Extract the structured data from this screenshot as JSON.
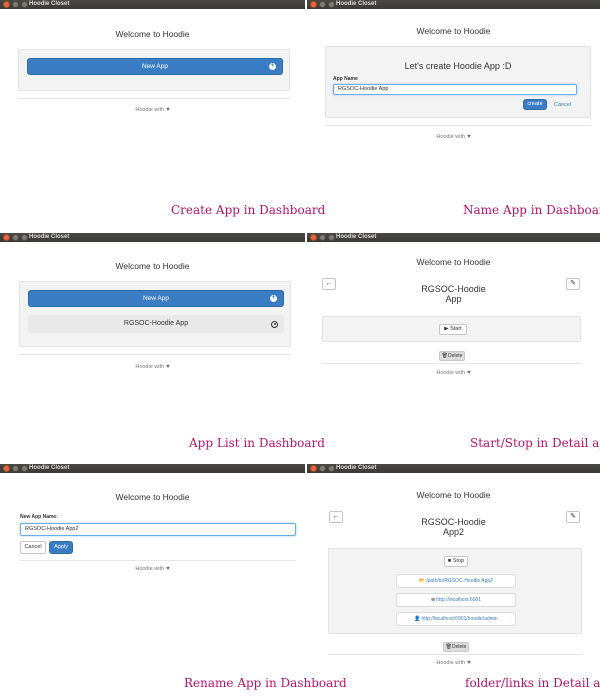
{
  "window_title": "Hoodie Closet",
  "welcome": "Welcome to Hoodie",
  "footer_text": "Hoodie with",
  "heart_icon": "♥",
  "colors": {
    "primary": "#3a7dc5",
    "caption": "#b4146e",
    "titlebar": "#3c3b37"
  },
  "panel1": {
    "new_app_label": "New App",
    "caption": "Create App in Dashboard"
  },
  "panel2": {
    "heading": "Let's create Hoodie App :D",
    "field_label": "App Name",
    "field_value": "RGSOC-Hoodie App",
    "create_label": "create",
    "cancel_label": "Cancel",
    "caption": "Name App in Dashboard"
  },
  "panel3": {
    "new_app_label": "New App",
    "list_item": "RGSOC-Hoodie App",
    "caption": "App List in Dashboard"
  },
  "panel4": {
    "app_name_line1": "RGSOC-Hoodie",
    "app_name_line2": "App",
    "start_label": "Start",
    "delete_label": "Delete",
    "caption": "Start/Stop in Detail app"
  },
  "panel5": {
    "field_label": "New App Name:",
    "field_value": "RGSOC-Hoodie App2",
    "cancel_label": "Cancel",
    "apply_label": "Apply",
    "caption": "Rename App in Dashboard"
  },
  "panel6": {
    "app_name_line1": "RGSOC-Hoodie",
    "app_name_line2": "App2",
    "stop_label": "Stop",
    "links": [
      "/path/to/RGSOC-Hoodie App2",
      "http://localhost:6001",
      "http://localhost:6001/hoodie/admin"
    ],
    "delete_label": "Delete",
    "caption": "folder/links in Detail app"
  }
}
